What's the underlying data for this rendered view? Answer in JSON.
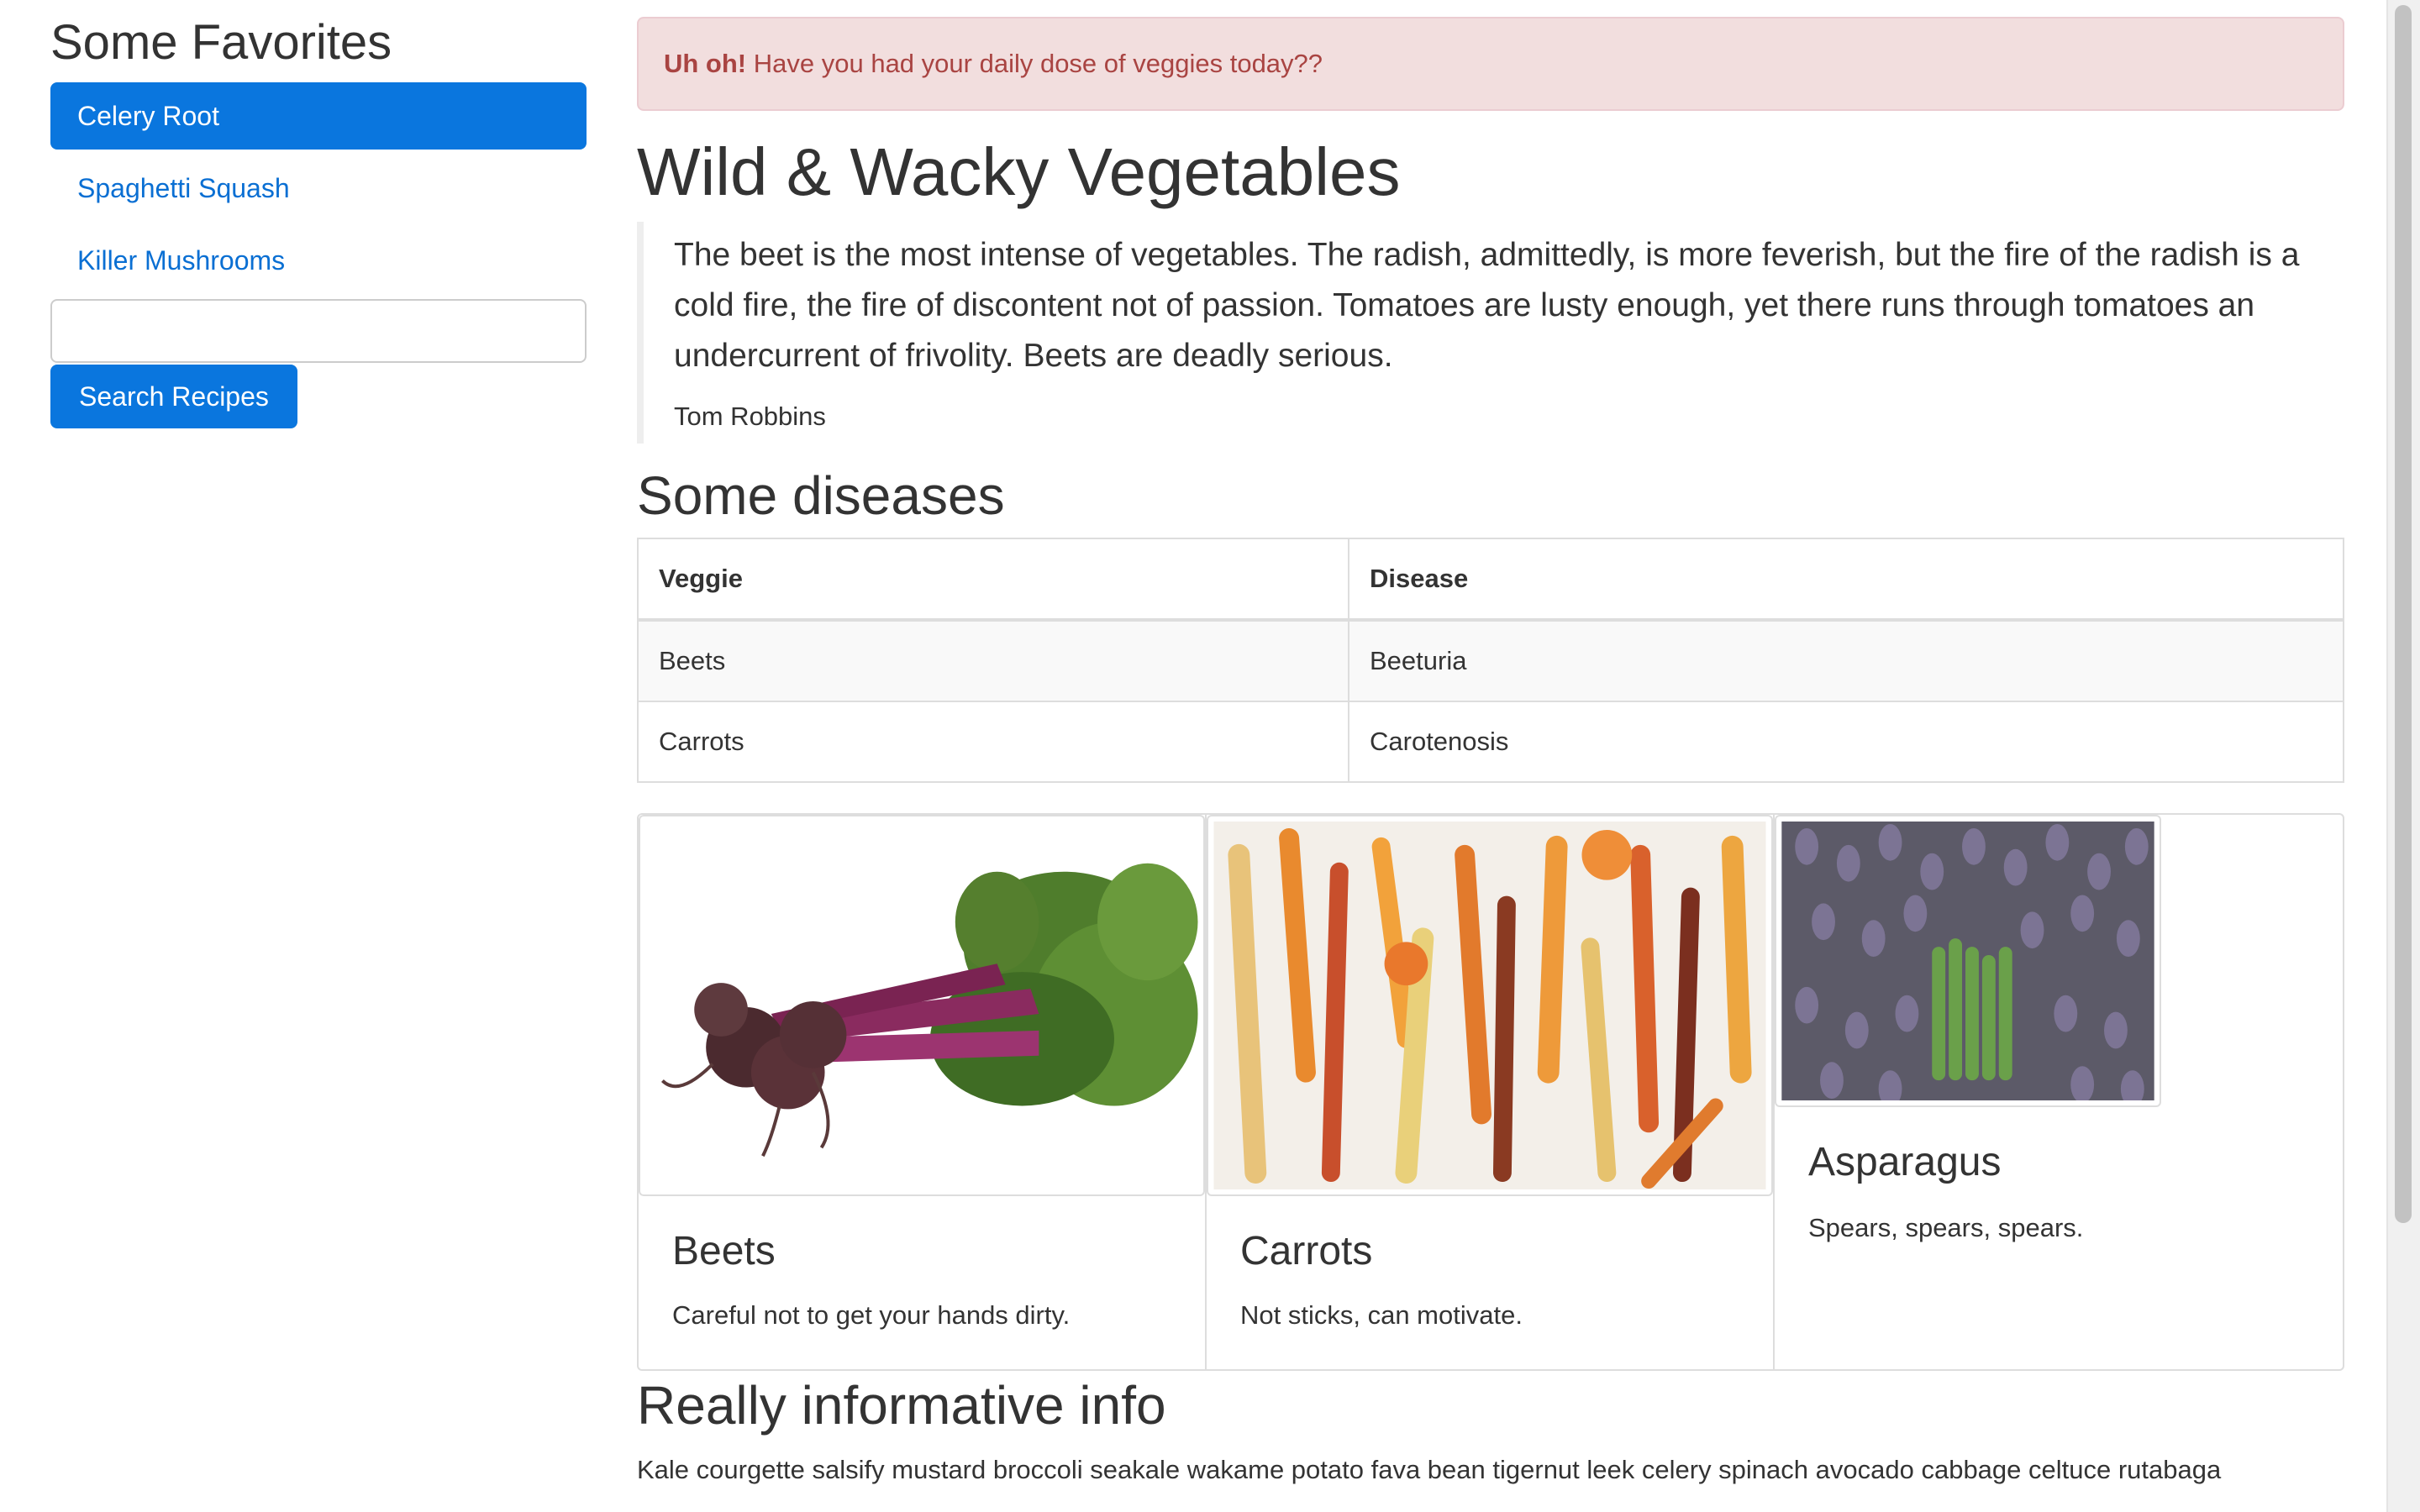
{
  "sidebar": {
    "title": "Some Favorites",
    "items": [
      {
        "label": "Celery Root",
        "active": true
      },
      {
        "label": "Spaghetti Squash",
        "active": false
      },
      {
        "label": "Killer Mushrooms",
        "active": false
      }
    ],
    "search_value": "",
    "search_button": "Search Recipes"
  },
  "alert": {
    "strong": "Uh oh!",
    "text": " Have you had your daily dose of veggies today??"
  },
  "main": {
    "title": "Wild & Wacky Vegetables",
    "quote": "The beet is the most intense of vegetables. The radish, admittedly, is more feverish, but the fire of the radish is a cold fire, the fire of discontent not of passion. Tomatoes are lusty enough, yet there runs through tomatoes an undercurrent of frivolity. Beets are deadly serious.",
    "quote_author": "Tom Robbins",
    "diseases_title": "Some diseases",
    "table": {
      "headers": [
        "Veggie",
        "Disease"
      ],
      "rows": [
        [
          "Beets",
          "Beeturia"
        ],
        [
          "Carrots",
          "Carotenosis"
        ]
      ]
    },
    "cards": [
      {
        "title": "Beets",
        "text": "Careful not to get your hands dirty.",
        "image": "beets-photo"
      },
      {
        "title": "Carrots",
        "text": "Not sticks, can motivate.",
        "image": "carrots-photo"
      },
      {
        "title": "Asparagus",
        "text": "Spears, spears, spears.",
        "image": "asparagus-photo"
      }
    ],
    "info_title": "Really informative info",
    "info_text": "Kale courgette salsify mustard broccoli seakale wakame potato fava bean tigernut leek celery spinach avocado cabbage celtuce rutabaga"
  },
  "colors": {
    "primary": "#0a76de",
    "link": "#0a6fd3",
    "alert_bg": "#f2dede",
    "alert_text": "#a94442"
  }
}
